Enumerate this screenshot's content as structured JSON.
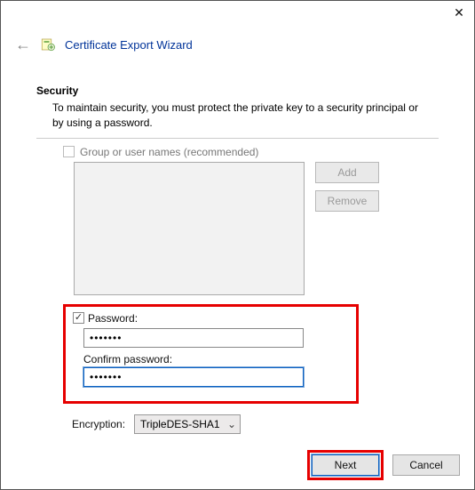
{
  "window": {
    "close_glyph": "✕"
  },
  "header": {
    "back_glyph": "←",
    "title": "Certificate Export Wizard"
  },
  "section": {
    "heading": "Security",
    "description": "To maintain security, you must protect the private key to a security principal or by using a password."
  },
  "group": {
    "checkbox_checked": false,
    "label": "Group or user names (recommended)",
    "add_label": "Add",
    "remove_label": "Remove"
  },
  "password": {
    "checkbox_checked": true,
    "label": "Password:",
    "value": "•••••••",
    "confirm_label": "Confirm password:",
    "confirm_value": "•••••••"
  },
  "encryption": {
    "label": "Encryption:",
    "selected": "TripleDES-SHA1"
  },
  "footer": {
    "next_label": "Next",
    "cancel_label": "Cancel"
  }
}
